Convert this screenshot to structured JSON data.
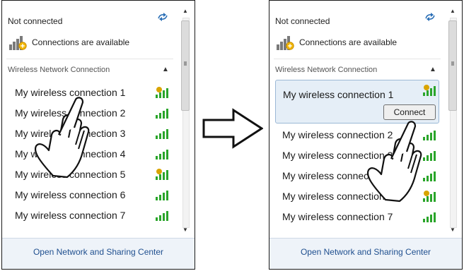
{
  "panel_left": {
    "status": "Not connected",
    "available_text": "Connections are available",
    "section_label": "Wireless Network Connection",
    "items": [
      {
        "label": "My wireless connection 1",
        "secured": true
      },
      {
        "label": "My wireless connection 2",
        "secured": false
      },
      {
        "label": "My wireless connection 3",
        "secured": false
      },
      {
        "label": "My wireless connection 4",
        "secured": false
      },
      {
        "label": "My wireless connection 5",
        "secured": true
      },
      {
        "label": "My wireless connection 6",
        "secured": false
      },
      {
        "label": "My wireless connection 7",
        "secured": false
      }
    ],
    "footer_link": "Open Network and Sharing Center"
  },
  "panel_right": {
    "status": "Not connected",
    "available_text": "Connections are available",
    "section_label": "Wireless Network Connection",
    "selected": {
      "label": "My wireless connection 1",
      "secured": true,
      "connect_button": "Connect"
    },
    "items": [
      {
        "label": "My wireless connection 2",
        "secured": false
      },
      {
        "label": "My wireless connection 3",
        "secured": false
      },
      {
        "label": "My wireless connection 4",
        "secured": false
      },
      {
        "label": "My wireless connection 5",
        "secured": true
      },
      {
        "label": "My wireless connection 7",
        "secured": false
      }
    ],
    "footer_link": "Open Network and Sharing Center"
  },
  "icons": {
    "refresh": "refresh-icon",
    "network_available": "network-available-icon",
    "collapse": "chevron-up-icon",
    "signal": "wifi-signal-icon",
    "pointer": "hand-pointer-icon",
    "transition": "arrow-right-icon"
  },
  "colors": {
    "selected_bg": "#e5eef7",
    "link": "#1f4f8f",
    "signal_green": "#2aa52a",
    "secured_shield": "#d9a400"
  }
}
